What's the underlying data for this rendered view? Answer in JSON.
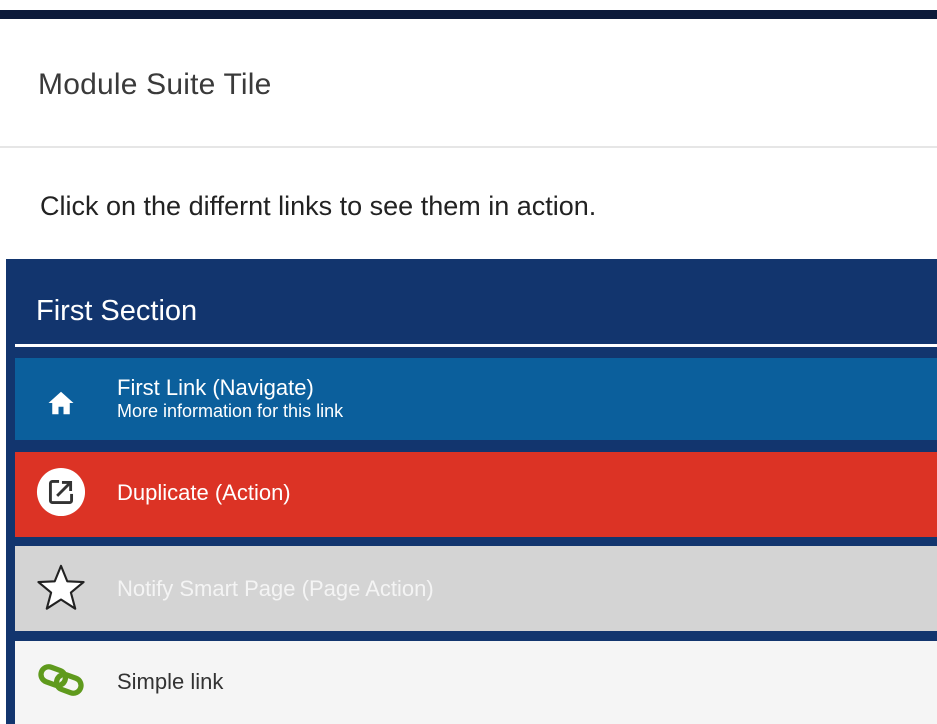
{
  "tile": {
    "title": "Module Suite Tile",
    "description": "Click on the differnt links to see them in action."
  },
  "section": {
    "title": "First Section",
    "links": [
      {
        "label": "First Link (Navigate)",
        "subtext": "More information for this link",
        "icon": "home-icon",
        "color": "#0b5f9c"
      },
      {
        "label": "Duplicate (Action)",
        "icon": "external-link-icon",
        "color": "#dc3325"
      },
      {
        "label": "Notify Smart Page (Page Action)",
        "icon": "star-outline-icon",
        "color": "#d4d4d4"
      },
      {
        "label": "Simple link",
        "icon": "chain-link-icon",
        "color": "#f5f5f5"
      }
    ]
  },
  "colors": {
    "top_bar": "#0c1a3a",
    "section_background": "#12356e",
    "link_icon_green": "#5f9a1d"
  }
}
